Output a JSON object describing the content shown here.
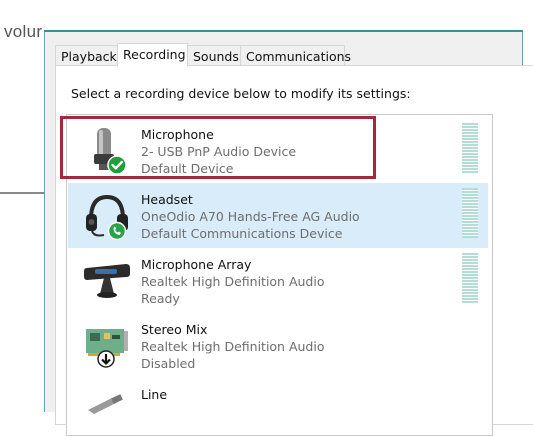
{
  "background": {
    "text": "volur"
  },
  "tabs": [
    {
      "label": "Playback"
    },
    {
      "label": "Recording"
    },
    {
      "label": "Sounds"
    },
    {
      "label": "Communications"
    }
  ],
  "instruction": "Select a recording device below to modify its settings:",
  "devices": [
    {
      "name": "Microphone",
      "description": "2- USB PnP Audio Device",
      "status": "Default Device",
      "icon": "usb-microphone-icon",
      "badge": "green-check"
    },
    {
      "name": "Headset",
      "description": "OneOdio A70 Hands-Free AG Audio",
      "status": "Default Communications Device",
      "icon": "headset-icon",
      "badge": "green-phone"
    },
    {
      "name": "Microphone Array",
      "description": "Realtek High Definition Audio",
      "status": "Ready",
      "icon": "microphone-array-icon"
    },
    {
      "name": "Stereo Mix",
      "description": "Realtek High Definition Audio",
      "status": "Disabled",
      "icon": "sound-card-icon",
      "badge": "black-down-arrow"
    },
    {
      "name": "Line",
      "description": "",
      "status": "",
      "icon": "line-in-icon"
    }
  ],
  "colors": {
    "selected_row": "#d9ecf9",
    "highlight_box": "#a22a3a",
    "meter": "#b4ddd7",
    "window_border": "#3c8e98"
  }
}
